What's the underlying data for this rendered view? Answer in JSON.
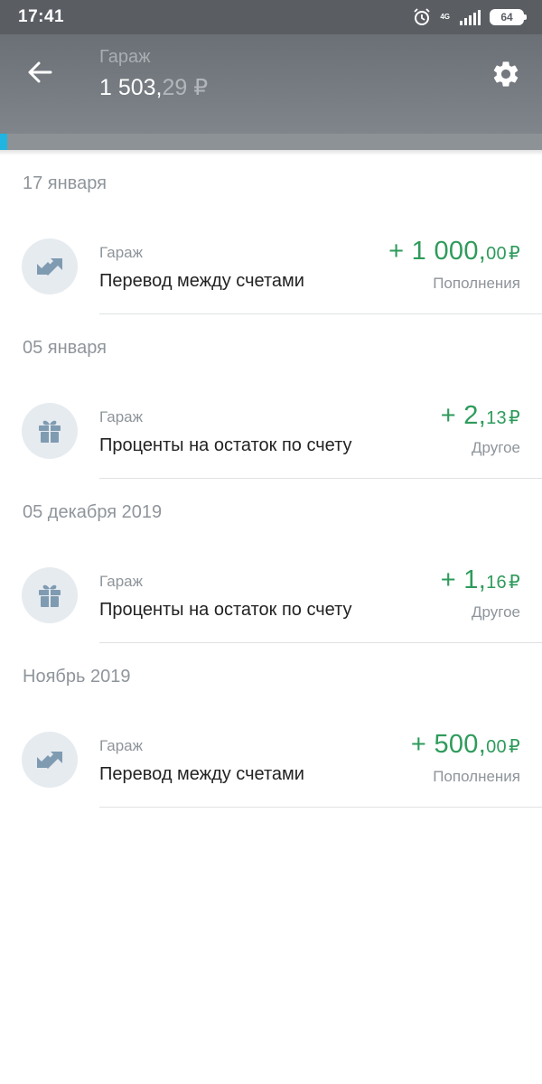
{
  "status_bar": {
    "time": "17:41",
    "network": "4G",
    "battery": "64"
  },
  "header": {
    "account_name": "Гараж",
    "balance_main": "1 503,",
    "balance_cents": "29 ₽",
    "progress_fraction": 0.013
  },
  "colors": {
    "income_green": "#2e9b5b",
    "header_gray": "#6b7076",
    "progress_blue": "#1fb5e0",
    "icon_bg": "#e6ebf0"
  },
  "groups": [
    {
      "date": "17 января",
      "items": [
        {
          "icon": "transfer-icon",
          "account": "Гараж",
          "title": "Перевод между счетами",
          "amount_main": "+ 1 000,",
          "amount_cents": "00",
          "currency": "₽",
          "category": "Пополнения"
        }
      ]
    },
    {
      "date": "05 января",
      "items": [
        {
          "icon": "gift-icon",
          "account": "Гараж",
          "title": "Проценты на остаток по счету",
          "amount_main": "+ 2,",
          "amount_cents": "13",
          "currency": "₽",
          "category": "Другое"
        }
      ]
    },
    {
      "date": "05 декабря 2019",
      "items": [
        {
          "icon": "gift-icon",
          "account": "Гараж",
          "title": "Проценты на остаток по счету",
          "amount_main": "+ 1,",
          "amount_cents": "16",
          "currency": "₽",
          "category": "Другое"
        }
      ]
    },
    {
      "date": "Ноябрь 2019",
      "items": [
        {
          "icon": "transfer-icon",
          "account": "Гараж",
          "title": "Перевод между счетами",
          "amount_main": "+ 500,",
          "amount_cents": "00",
          "currency": "₽",
          "category": "Пополнения"
        }
      ]
    }
  ]
}
